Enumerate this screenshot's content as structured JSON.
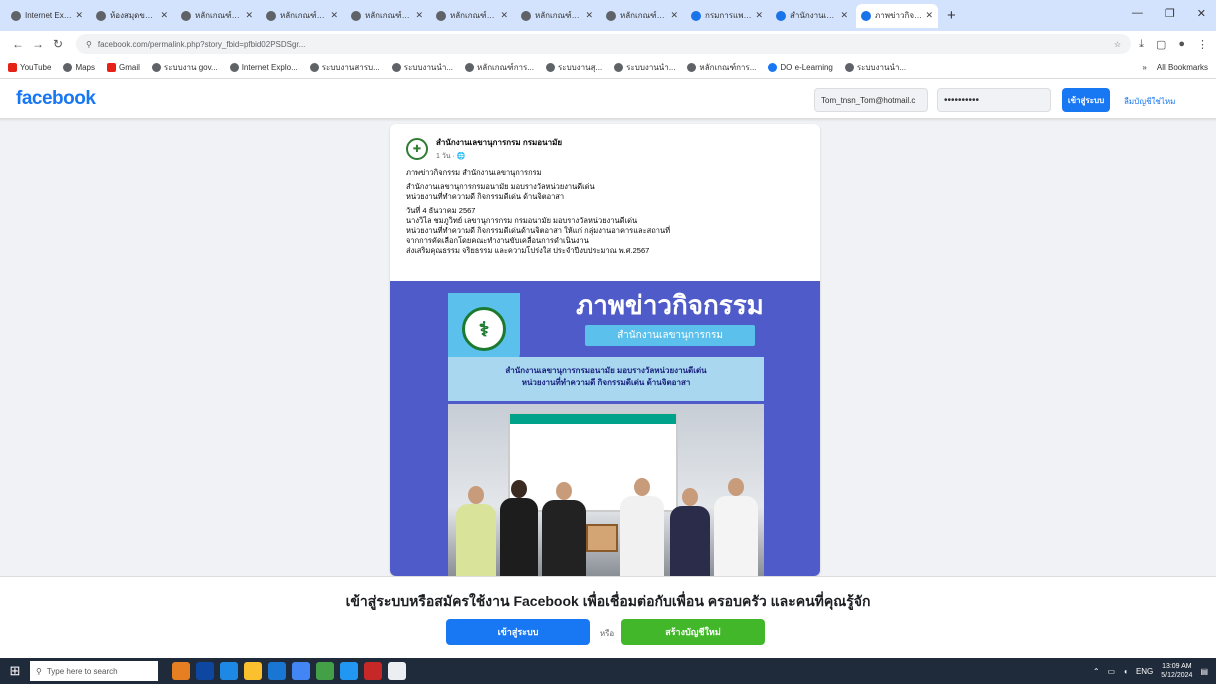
{
  "browser": {
    "tabs": [
      {
        "title": "Internet Explo...",
        "active": false
      },
      {
        "title": "ห้องสมุดของ...",
        "active": false
      },
      {
        "title": "หลักเกณฑ์การ...",
        "active": false
      },
      {
        "title": "หลักเกณฑ์การ...",
        "active": false
      },
      {
        "title": "หลักเกณฑ์การ...",
        "active": false
      },
      {
        "title": "หลักเกณฑ์การ...",
        "active": false
      },
      {
        "title": "หลักเกณฑ์การ...",
        "active": false
      },
      {
        "title": "หลักเกณฑ์การ...",
        "active": false
      },
      {
        "title": "กรมการแพทย์...",
        "active": false
      },
      {
        "title": "สำนักงานเลข...",
        "active": false
      },
      {
        "title": "ภาพข่าวกิจกร...",
        "active": true
      }
    ],
    "new_tab": "+",
    "window_controls": {
      "minimize": "—",
      "maximize": "❐",
      "close": "✕"
    },
    "url": "facebook.com/permalink.php?story_fbid=pfbid02PSDSgr...",
    "bookmarks": [
      "YouTube",
      "Maps",
      "Gmail",
      "ระบบงาน gov...",
      "Internet Explo...",
      "ระบบงานสารบ...",
      "ระบบงานนำ...",
      "หลักเกณฑ์การ...",
      "ระบบงานสุ...",
      "ระบบงานนำ...",
      "หลักเกณฑ์การ...",
      "DO e-Learning",
      "ระบบงานนำ..."
    ],
    "bookmarks_right": "All Bookmarks"
  },
  "fb": {
    "logo": "facebook",
    "email_value": "Tom_tnsn_Tom@hotmail.c",
    "password_value": "••••••••••",
    "login_label": "เข้าสู่ระบบ",
    "forgot_label": "ลืมบัญชีใช่ไหม"
  },
  "post": {
    "page_name": "สำนักงานเลขานุการกรม กรมอนามัย",
    "time": "1 วัน · 🌐",
    "lines": [
      "ภาพข่าวกิจกรรม สำนักงานเลขานุการกรม",
      "สำนักงานเลขานุการกรมอนามัย มอบรางวัลหน่วยงานดีเด่น",
      "หน่วยงานที่ทำความดี กิจกรรมดีเด่น ด้านจิตอาสา",
      "วันที่ 4 ธันวาคม 2567",
      "นางวิไล ชมภูวิทย์ เลขานุการกรม กรมอนามัย มอบรางวัลหน่วยงานดีเด่น",
      "หน่วยงานที่ทำความดี กิจกรรมดีเด่นด้านจิตอาสา ให้แก่ กลุ่มงานอาคารและสถานที่",
      "จากการคัดเลือกโดยคณะทำงานขับเคลื่อนการดำเนินงาน",
      "ส่งเสริมคุณธรรม จริยธรรม และความโปร่งใส ประจำปีงบประมาณ พ.ศ.2567"
    ],
    "banner_title": "ภาพข่าวกิจกรรม",
    "banner_sub": "สำนักงานเลขานุการกรม",
    "banner_line1": "สำนักงานเลขานุการกรมอนามัย มอบรางวัลหน่วยงานดีเด่น",
    "banner_line2": "หน่วยงานที่ทำความดี กิจกรรมดีเด่น ด้านจิตอาสา"
  },
  "prompt": {
    "text": "เข้าสู่ระบบหรือสมัครใช้งาน Facebook เพื่อเชื่อมต่อกับเพื่อน ครอบครัว และคนที่คุณรู้จัก",
    "login_label": "เข้าสู่ระบบ",
    "or_label": "หรือ",
    "create_label": "สร้างบัญชีใหม่"
  },
  "taskbar": {
    "search_placeholder": "Type here to search",
    "lang": "ENG",
    "time": "13:09 AM",
    "date": "5/12/2024"
  },
  "colors": {
    "fb_blue": "#1877f2",
    "create_green": "#42b72a",
    "banner_bg": "#4f5bc8"
  }
}
